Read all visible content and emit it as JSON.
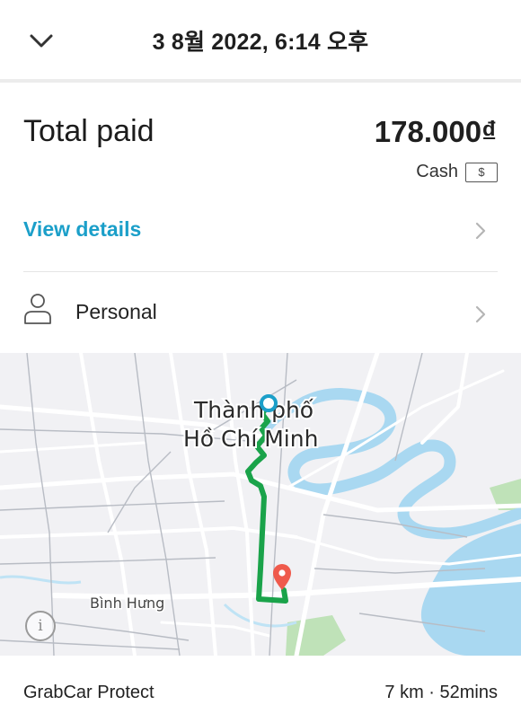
{
  "header": {
    "title": "3 8월 2022, 6:14 오후"
  },
  "payment": {
    "total_label": "Total paid",
    "total_amount": "178.000₫",
    "method": "Cash",
    "method_icon_glyph": "$"
  },
  "links": {
    "view_details": "View details"
  },
  "profile": {
    "label": "Personal"
  },
  "map": {
    "city_label_line1": "Thành phố",
    "city_label_line2": "Hồ Chí Minh",
    "district_label": "Bình Hưng",
    "info_glyph": "i",
    "route_color": "#1aa34a",
    "pickup_color": "#1b9fc9",
    "dropoff_color": "#ef5a4c",
    "water_color": "#a9d8f1",
    "park_color": "#bfe2b8"
  },
  "trip": {
    "service": "GrabCar Protect",
    "distance_duration": "7 km · 52mins"
  },
  "colors": {
    "accent_link": "#1b9fc9",
    "text_primary": "#1f1f1f"
  }
}
